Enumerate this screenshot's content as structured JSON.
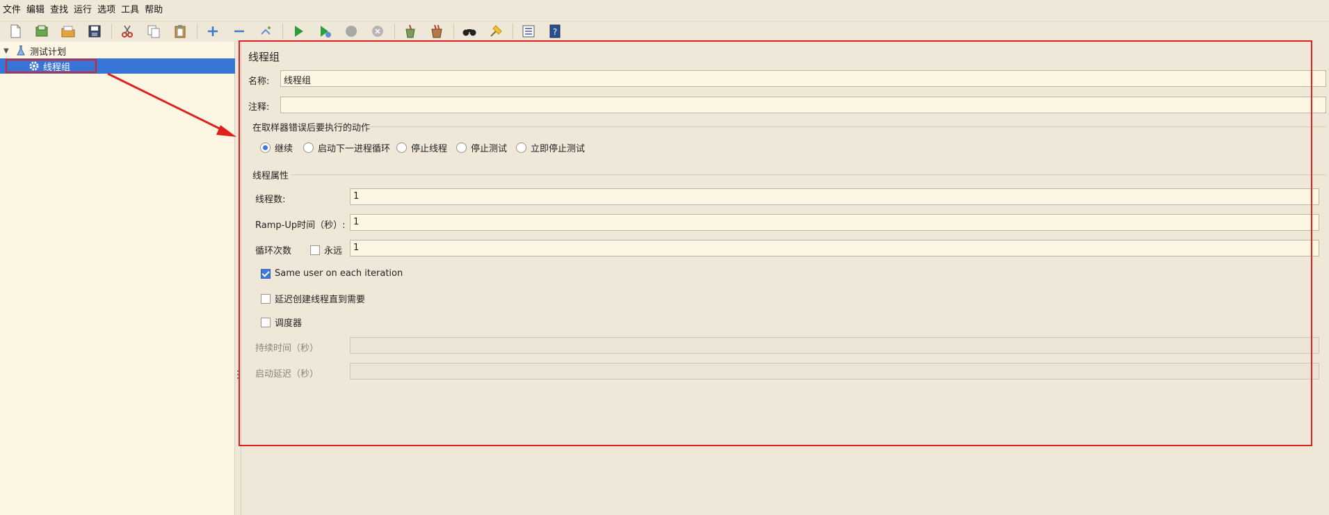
{
  "menu": [
    "文件",
    "编辑",
    "查找",
    "运行",
    "选项",
    "工具",
    "帮助"
  ],
  "toolbar": {
    "icons": [
      "new-icon",
      "templates-icon",
      "open-icon",
      "save-icon",
      "cut-icon",
      "copy-icon",
      "paste-icon",
      "expand-icon",
      "collapse-icon",
      "toggle-icon",
      "start-icon",
      "start-no-pauses-icon",
      "stop-icon",
      "shutdown-icon",
      "clear-icon",
      "clear-all-icon",
      "search-icon",
      "reset-search-icon",
      "function-helper-icon",
      "help-icon"
    ]
  },
  "tree": {
    "root_label": "测试计划",
    "child_label": "线程组"
  },
  "panel": {
    "title": "线程组",
    "name_label": "名称:",
    "name_value": "线程组",
    "comment_label": "注释:",
    "comment_value": "",
    "error_group_title": "在取样器错误后要执行的动作",
    "error_options": [
      "继续",
      "启动下一进程循环",
      "停止线程",
      "停止测试",
      "立即停止测试"
    ],
    "error_selected": "继续",
    "thread_group_title": "线程属性",
    "threads_label": "线程数:",
    "threads_value": "1",
    "rampup_label": "Ramp-Up时间（秒）:",
    "rampup_value": "1",
    "loop_label": "循环次数",
    "forever_label": "永远",
    "forever_checked": false,
    "loop_value": "1",
    "same_user_label": "Same user on each iteration",
    "same_user_checked": true,
    "delay_create_label": "延迟创建线程直到需要",
    "delay_create_checked": false,
    "scheduler_label": "调度器",
    "scheduler_checked": false,
    "duration_label": "持续时间（秒）",
    "duration_value": "",
    "startup_delay_label": "启动延迟（秒）",
    "startup_delay_value": ""
  },
  "colors": {
    "selection": "#3875d7",
    "highlight_red": "#e0201e",
    "background": "#efe8d8",
    "field": "#fdf6e3"
  }
}
